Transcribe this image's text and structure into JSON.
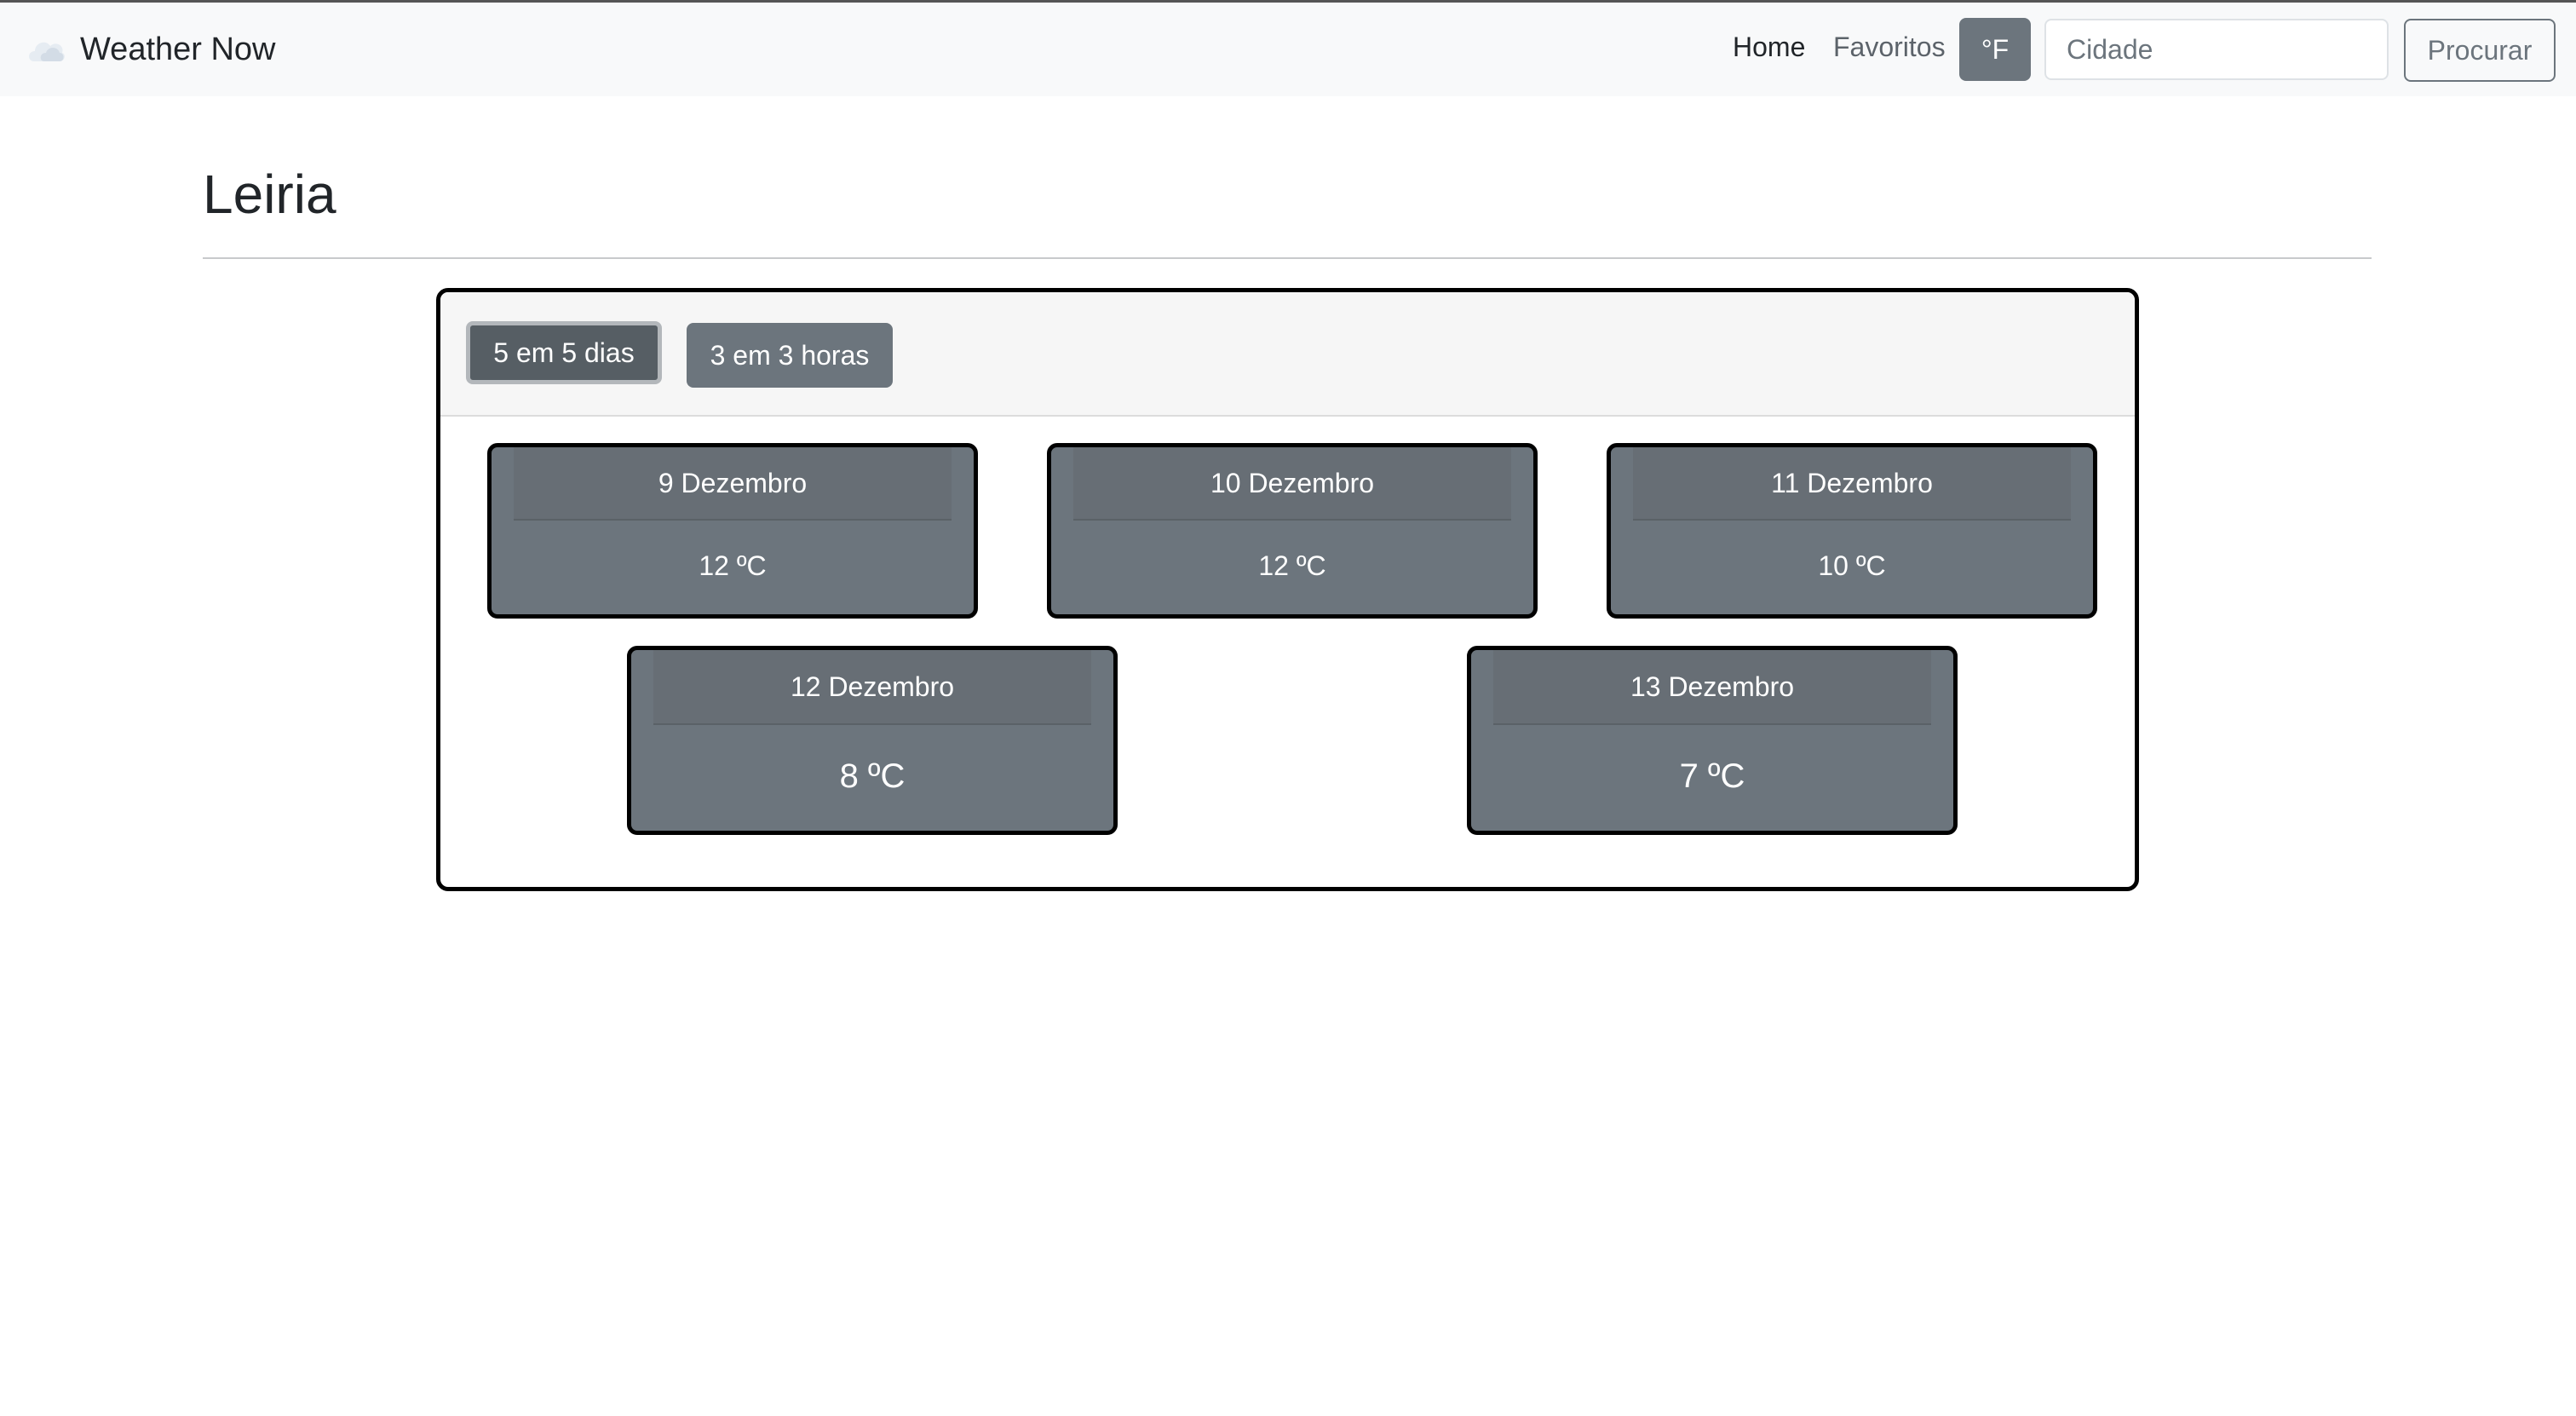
{
  "navbar": {
    "brand_title": "Weather Now",
    "brand_icon": "cloud-icon",
    "links": {
      "home": "Home",
      "favorites": "Favoritos"
    },
    "unit_toggle_label": "°F",
    "search": {
      "placeholder": "Cidade",
      "value": "",
      "button_label": "Procurar"
    }
  },
  "page": {
    "title": "Leiria"
  },
  "forecast": {
    "tabs": [
      {
        "label": "5 em 5 dias",
        "active": true
      },
      {
        "label": "3 em 3 horas",
        "active": false
      }
    ],
    "days": [
      {
        "date": "9 Dezembro",
        "temp": "12 ºC"
      },
      {
        "date": "10 Dezembro",
        "temp": "12 ºC"
      },
      {
        "date": "11 Dezembro",
        "temp": "10 ºC"
      },
      {
        "date": "12 Dezembro",
        "temp": "8 ºC"
      },
      {
        "date": "13 Dezembro",
        "temp": "7 ºC"
      }
    ]
  },
  "colors": {
    "card_bg": "#6c757d",
    "navbar_bg": "#f8f9fa",
    "active_tab_bg": "#565e64"
  }
}
